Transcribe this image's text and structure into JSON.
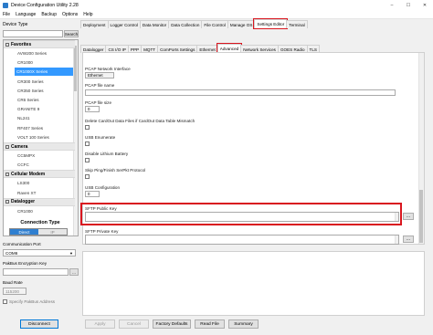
{
  "window": {
    "title": "Device Configuration Utility 2.28",
    "controls": [
      "–",
      "☐",
      "✕"
    ]
  },
  "menu": [
    "File",
    "Language",
    "Backup",
    "Options",
    "Help"
  ],
  "left": {
    "device_type_label": "Device Type",
    "search_button": "Search",
    "tree": [
      {
        "kind": "cat",
        "label": "Favorites"
      },
      {
        "kind": "item",
        "label": "AVW200 Series"
      },
      {
        "kind": "item",
        "label": "CR1000"
      },
      {
        "kind": "item",
        "label": "CR1000X Series",
        "selected": true
      },
      {
        "kind": "item",
        "label": "CR300 Series"
      },
      {
        "kind": "item",
        "label": "CR350 Series"
      },
      {
        "kind": "item",
        "label": "CR6 Series"
      },
      {
        "kind": "item",
        "label": "GRANITE 9"
      },
      {
        "kind": "item",
        "label": "NL241"
      },
      {
        "kind": "item",
        "label": "RF407 Series"
      },
      {
        "kind": "item",
        "label": "VOLT 100 Series"
      },
      {
        "kind": "cat",
        "label": "Camera"
      },
      {
        "kind": "item",
        "label": "CC5MPX"
      },
      {
        "kind": "item",
        "label": "CCFC"
      },
      {
        "kind": "cat",
        "label": "Cellular Modem"
      },
      {
        "kind": "item",
        "label": "LS300"
      },
      {
        "kind": "item",
        "label": "Raven XT"
      },
      {
        "kind": "cat",
        "label": "Datalogger"
      },
      {
        "kind": "item",
        "label": "CR1000"
      }
    ],
    "connection": {
      "title": "Connection Type",
      "options": [
        "Direct",
        "IP"
      ],
      "port_label": "Communication Port",
      "port_value": "COM6",
      "encryption_label": "PakBus Encryption Key",
      "encryption_btn": "...",
      "baud_label": "Baud Rate",
      "baud_value": "115200",
      "specify_label": "Specify PakBus Address",
      "disconnect": "Disconnect"
    }
  },
  "main_tabs": [
    "Deployment",
    "Logger Control",
    "Data Monitor",
    "Data Collection",
    "File Control",
    "Manage OS",
    "Settings Editor",
    "Terminal"
  ],
  "sub_tabs": [
    "Datalogger",
    "CS I/O IP",
    "PPP",
    "MQTT",
    "ComPorts Settings",
    "Ethernet",
    "Advanced",
    "Network Services",
    "GOES Radio",
    "TLS"
  ],
  "fields": {
    "pcap_iface_label": "PCAP Network Interface",
    "pcap_iface_value": "Ethernet",
    "pcap_file_label": "PCAP file name",
    "pcap_size_label": "PCAP file size",
    "pcap_size_value": "0",
    "delete_cardout_label": "Delete CardOut Data Files if CardOut Data Table Mismatch",
    "usb_enum_label": "USB Enumerate",
    "disable_li_label": "Disable Lithium Battery",
    "skip_ping_label": "Skip Ping/Finish SerPkt Protocol",
    "usb_config_label": "USB Configuration",
    "usb_config_value": "0",
    "sftp_public_label": "SFTP Public Key",
    "sftp_private_label": "SFTP Private Key",
    "dots": "..."
  },
  "bottom_buttons": [
    "Apply",
    "Cancel",
    "Factory Defaults",
    "Read File",
    "Summary"
  ]
}
